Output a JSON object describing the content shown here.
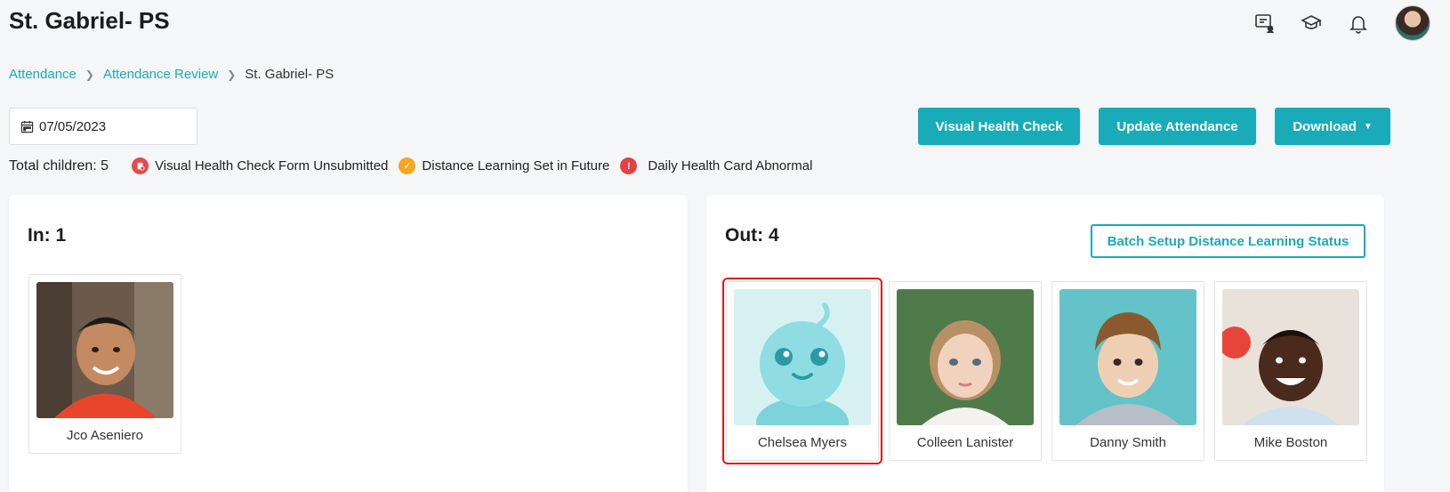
{
  "page": {
    "title": "St. Gabriel- PS"
  },
  "breadcrumb": {
    "items": [
      "Attendance",
      "Attendance Review"
    ],
    "current": "St. Gabriel- PS"
  },
  "filters": {
    "date": "07/05/2023"
  },
  "actions": {
    "visual_health_check": "Visual Health Check",
    "update_attendance": "Update Attendance",
    "download": "Download"
  },
  "summary": {
    "total_children": "Total children: 5",
    "legend": [
      {
        "label": "Visual Health Check Form Unsubmitted",
        "icon": "form-unsubmitted-icon",
        "color": "#e54b4b"
      },
      {
        "label": "Distance Learning Set in Future",
        "icon": "check-circle-icon",
        "color": "#f5a623"
      },
      {
        "label": "Daily Health Card Abnormal",
        "icon": "alert-icon",
        "color": "#e54040"
      }
    ]
  },
  "in_panel": {
    "title": "In: 1",
    "children": [
      {
        "name": "Jco Aseniero",
        "photo": "child-photo"
      }
    ]
  },
  "out_panel": {
    "title": "Out: 4",
    "batch_button": "Batch Setup Distance Learning Status",
    "children": [
      {
        "name": "Chelsea Myers",
        "photo": "default-avatar",
        "selected": true
      },
      {
        "name": "Colleen Lanister",
        "photo": "child-photo"
      },
      {
        "name": "Danny Smith",
        "photo": "child-photo"
      },
      {
        "name": "Mike Boston",
        "photo": "child-photo"
      }
    ]
  },
  "colors": {
    "accent": "#1aabb8",
    "highlight": "#e3141b",
    "background": "#f4f6f8"
  }
}
